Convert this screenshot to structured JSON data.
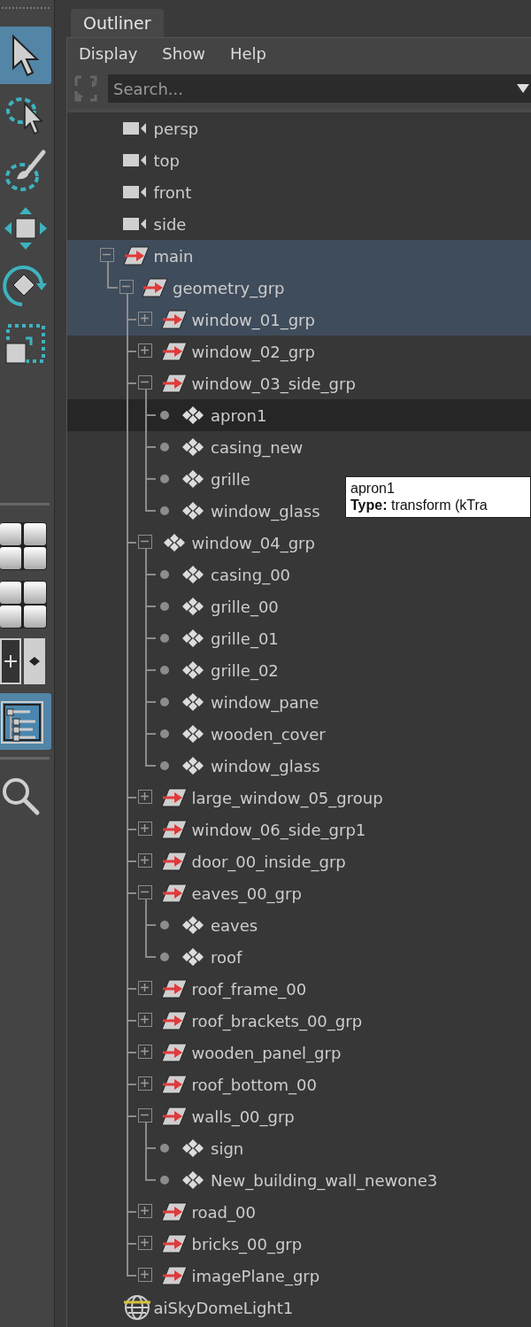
{
  "toolbar": {
    "tools": [
      {
        "kind": "select",
        "selected": true
      },
      {
        "kind": "lasso",
        "selected": false
      },
      {
        "kind": "paint",
        "selected": false
      },
      {
        "kind": "move",
        "selected": false
      },
      {
        "kind": "rotate",
        "selected": false
      },
      {
        "kind": "scale",
        "selected": false
      }
    ],
    "panels": [
      {
        "kind": "grid",
        "selected": false
      },
      {
        "kind": "grid",
        "selected": false
      },
      {
        "kind": "keys",
        "selected": false
      },
      {
        "kind": "outliner",
        "selected": true
      },
      {
        "kind": "search",
        "selected": false
      }
    ]
  },
  "tab": {
    "label": "Outliner"
  },
  "menu": [
    "Display",
    "Show",
    "Help"
  ],
  "search": {
    "placeholder": "Search..."
  },
  "tree": [
    {
      "label": "persp",
      "kind": "camera",
      "selected": false,
      "hovered": false
    },
    {
      "label": "top",
      "kind": "camera",
      "selected": false,
      "hovered": false
    },
    {
      "label": "front",
      "kind": "camera",
      "selected": false,
      "hovered": false
    },
    {
      "label": "side",
      "kind": "camera",
      "selected": false,
      "hovered": false
    },
    {
      "label": "main",
      "kind": "transform",
      "selected": true,
      "hovered": false,
      "expanded": true,
      "children": [
        {
          "label": "geometry_grp",
          "kind": "transform",
          "selected": true,
          "hovered": false,
          "expanded": true,
          "children": [
            {
              "label": "window_01_grp",
              "kind": "transform",
              "selected": true,
              "hovered": false,
              "expanded": false
            },
            {
              "label": "window_02_grp",
              "kind": "transform",
              "selected": false,
              "hovered": false,
              "expanded": false
            },
            {
              "label": "window_03_side_grp",
              "kind": "transform",
              "selected": false,
              "hovered": false,
              "expanded": true,
              "children": [
                {
                  "label": "apron1",
                  "kind": "mesh",
                  "selected": false,
                  "hovered": true
                },
                {
                  "label": "casing_new",
                  "kind": "mesh",
                  "selected": false,
                  "hovered": false
                },
                {
                  "label": "grille",
                  "kind": "mesh",
                  "selected": false,
                  "hovered": false
                },
                {
                  "label": "window_glass",
                  "kind": "mesh",
                  "selected": false,
                  "hovered": false
                }
              ]
            },
            {
              "label": "window_04_grp",
              "kind": "mesh",
              "selected": false,
              "hovered": false,
              "expanded": true,
              "children": [
                {
                  "label": "casing_00",
                  "kind": "mesh",
                  "selected": false,
                  "hovered": false
                },
                {
                  "label": "grille_00",
                  "kind": "mesh",
                  "selected": false,
                  "hovered": false
                },
                {
                  "label": "grille_01",
                  "kind": "mesh",
                  "selected": false,
                  "hovered": false
                },
                {
                  "label": "grille_02",
                  "kind": "mesh",
                  "selected": false,
                  "hovered": false
                },
                {
                  "label": "window_pane",
                  "kind": "mesh",
                  "selected": false,
                  "hovered": false
                },
                {
                  "label": "wooden_cover",
                  "kind": "mesh",
                  "selected": false,
                  "hovered": false
                },
                {
                  "label": "window_glass",
                  "kind": "mesh",
                  "selected": false,
                  "hovered": false
                }
              ]
            },
            {
              "label": "large_window_05_group",
              "kind": "transform",
              "selected": false,
              "hovered": false,
              "expanded": false
            },
            {
              "label": "window_06_side_grp1",
              "kind": "transform",
              "selected": false,
              "hovered": false,
              "expanded": false
            },
            {
              "label": "door_00_inside_grp",
              "kind": "transform",
              "selected": false,
              "hovered": false,
              "expanded": false
            },
            {
              "label": "eaves_00_grp",
              "kind": "transform",
              "selected": false,
              "hovered": false,
              "expanded": true,
              "children": [
                {
                  "label": "eaves",
                  "kind": "mesh",
                  "selected": false,
                  "hovered": false
                },
                {
                  "label": "roof",
                  "kind": "mesh",
                  "selected": false,
                  "hovered": false
                }
              ]
            },
            {
              "label": "roof_frame_00",
              "kind": "transform",
              "selected": false,
              "hovered": false,
              "expanded": false
            },
            {
              "label": "roof_brackets_00_grp",
              "kind": "transform",
              "selected": false,
              "hovered": false,
              "expanded": false
            },
            {
              "label": "wooden_panel_grp",
              "kind": "transform",
              "selected": false,
              "hovered": false,
              "expanded": false
            },
            {
              "label": "roof_bottom_00",
              "kind": "transform",
              "selected": false,
              "hovered": false,
              "expanded": false
            },
            {
              "label": "walls_00_grp",
              "kind": "transform",
              "selected": false,
              "hovered": false,
              "expanded": true,
              "children": [
                {
                  "label": "sign",
                  "kind": "mesh",
                  "selected": false,
                  "hovered": false
                },
                {
                  "label": "New_building_wall_newone3",
                  "kind": "mesh",
                  "selected": false,
                  "hovered": false
                }
              ]
            },
            {
              "label": "road_00",
              "kind": "transform",
              "selected": false,
              "hovered": false,
              "expanded": false
            },
            {
              "label": "bricks_00_grp",
              "kind": "transform",
              "selected": false,
              "hovered": false,
              "expanded": false
            },
            {
              "label": "imagePlane_grp",
              "kind": "transform",
              "selected": false,
              "hovered": false,
              "expanded": false
            }
          ]
        }
      ]
    },
    {
      "label": "aiSkyDomeLight1",
      "kind": "light",
      "selected": false,
      "hovered": false
    }
  ],
  "tooltip": {
    "title": "apron1",
    "detail": "**Type:** transform (kTra"
  }
}
